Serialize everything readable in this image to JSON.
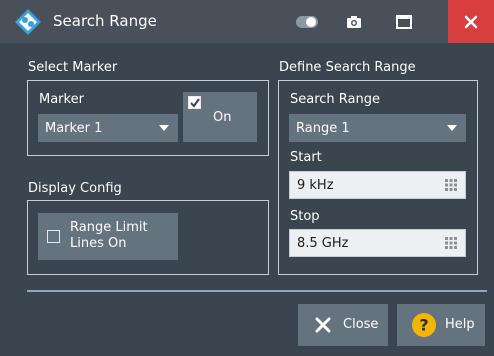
{
  "window": {
    "title": "Search Range"
  },
  "colors": {
    "close_bg": "#d73e3e",
    "button_bg": "#65737f",
    "help_icon": "#f2b705"
  },
  "select_marker": {
    "group_title": "Select Marker",
    "marker_label": "Marker",
    "marker_value": "Marker 1",
    "on_button": {
      "label": "On",
      "checked": true
    }
  },
  "display_config": {
    "group_title": "Display Config",
    "range_limit_button": {
      "line1": "Range Limit",
      "line2": "Lines On",
      "checked": false
    }
  },
  "define_search_range": {
    "group_title": "Define Search Range",
    "search_range_label": "Search Range",
    "search_range_value": "Range 1",
    "start_label": "Start",
    "start_value": "9 kHz",
    "stop_label": "Stop",
    "stop_value": "8.5 GHz"
  },
  "footer": {
    "close_label": "Close",
    "help_label": "Help"
  },
  "icons": [
    "app-logo-icon",
    "toggle-icon",
    "camera-icon",
    "maximize-icon",
    "close-icon",
    "chevron-down-icon",
    "keypad-icon",
    "x-icon",
    "help-icon"
  ]
}
